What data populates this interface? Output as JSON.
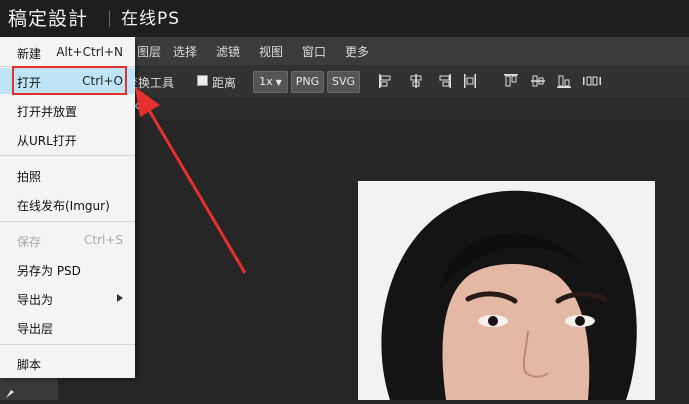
{
  "brand": {
    "title": "稿定設計",
    "subtitle": "在线PS"
  },
  "menubar": {
    "items": [
      "图层",
      "选择",
      "滤镜",
      "视图",
      "窗口",
      "更多"
    ]
  },
  "toolbar": {
    "transform_label": "变换工具",
    "distance_label": "距离",
    "scale_label": "1x",
    "png_label": "PNG",
    "svg_label": "SVG"
  },
  "tabstrip": {
    "close_glyph": "×"
  },
  "file_menu": {
    "items": [
      {
        "label": "新建",
        "shortcut": "Alt+Ctrl+N"
      },
      {
        "label": "打开",
        "shortcut": "Ctrl+O"
      },
      {
        "label": "打开并放置",
        "shortcut": ""
      },
      {
        "label": "从URL打开",
        "shortcut": ""
      },
      {
        "label": "拍照",
        "shortcut": ""
      },
      {
        "label": "在线发布(Imgur)",
        "shortcut": ""
      },
      {
        "label": "保存",
        "shortcut": "Ctrl+S"
      },
      {
        "label": "另存为 PSD",
        "shortcut": ""
      },
      {
        "label": "导出为",
        "shortcut": ""
      },
      {
        "label": "导出层",
        "shortcut": ""
      },
      {
        "label": "脚本",
        "shortcut": ""
      }
    ]
  },
  "colors": {
    "highlight": "#bfe4f5",
    "annotation_red": "#e53030"
  }
}
